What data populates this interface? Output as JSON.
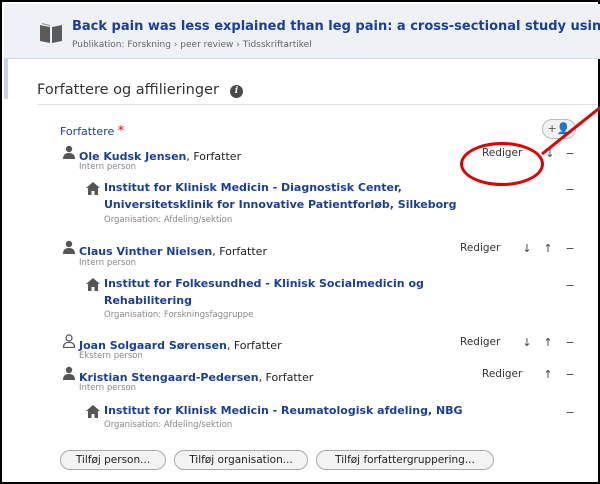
{
  "header": {
    "title": "Back pain was less explained than leg pain: a cross-sectional study using",
    "subtitle": "Publikation: Forskning › peer review › Tidsskriftartikel"
  },
  "section": {
    "title": "Forfattere og affilieringer",
    "info_glyph": "i",
    "authors_label": "Forfattere",
    "required_mark": "*",
    "add_glyph": "+👤"
  },
  "authors": [
    {
      "name": "Ole Kudsk Jensen",
      "role": ", Forfatter",
      "type": "Intern person",
      "edit": "Rediger",
      "controls": [
        "↓",
        "−"
      ],
      "orgs": [
        {
          "line1": "Institut for Klinisk Medicin - Diagnostisk Center,",
          "line2": "Universitetsklinik for Innovative Patientforløb, Silkeborg",
          "type": "Organisation: Afdeling/sektion",
          "remove": "−"
        }
      ]
    },
    {
      "name": "Claus Vinther Nielsen",
      "role": ", Forfatter",
      "type": "Intern person",
      "edit": "Rediger",
      "controls": [
        "↓",
        "↑",
        "−"
      ],
      "orgs": [
        {
          "line1": "Institut for Folkesundhed - Klinisk Socialmedicin og",
          "line2": "Rehabilitering",
          "type": "Organisation: Forskningsfaggruppe",
          "remove": "−"
        }
      ]
    },
    {
      "name": "Joan Solgaard Sørensen",
      "role": ", Forfatter",
      "type": "Ekstern person",
      "edit": "Rediger",
      "controls": [
        "↓",
        "↑",
        "−"
      ],
      "orgs": []
    },
    {
      "name": "Kristian Stengaard-Pedersen",
      "role": ", Forfatter",
      "type": "Intern person",
      "edit": "Rediger",
      "controls": [
        "↑",
        "−"
      ],
      "orgs": [
        {
          "line1": "Institut for Klinisk Medicin - Reumatologisk afdeling, NBG",
          "line2": "",
          "type": "Organisation: Afdeling/sektion",
          "remove": "−"
        }
      ]
    }
  ],
  "buttons": {
    "add_person": "Tilføj person...",
    "add_org": "Tilføj organisation...",
    "add_group": "Tilføj forfattergruppering..."
  },
  "colors": {
    "link": "#1a3f9a",
    "annotation": "#e00000",
    "header_bg": "#eef2f7"
  }
}
